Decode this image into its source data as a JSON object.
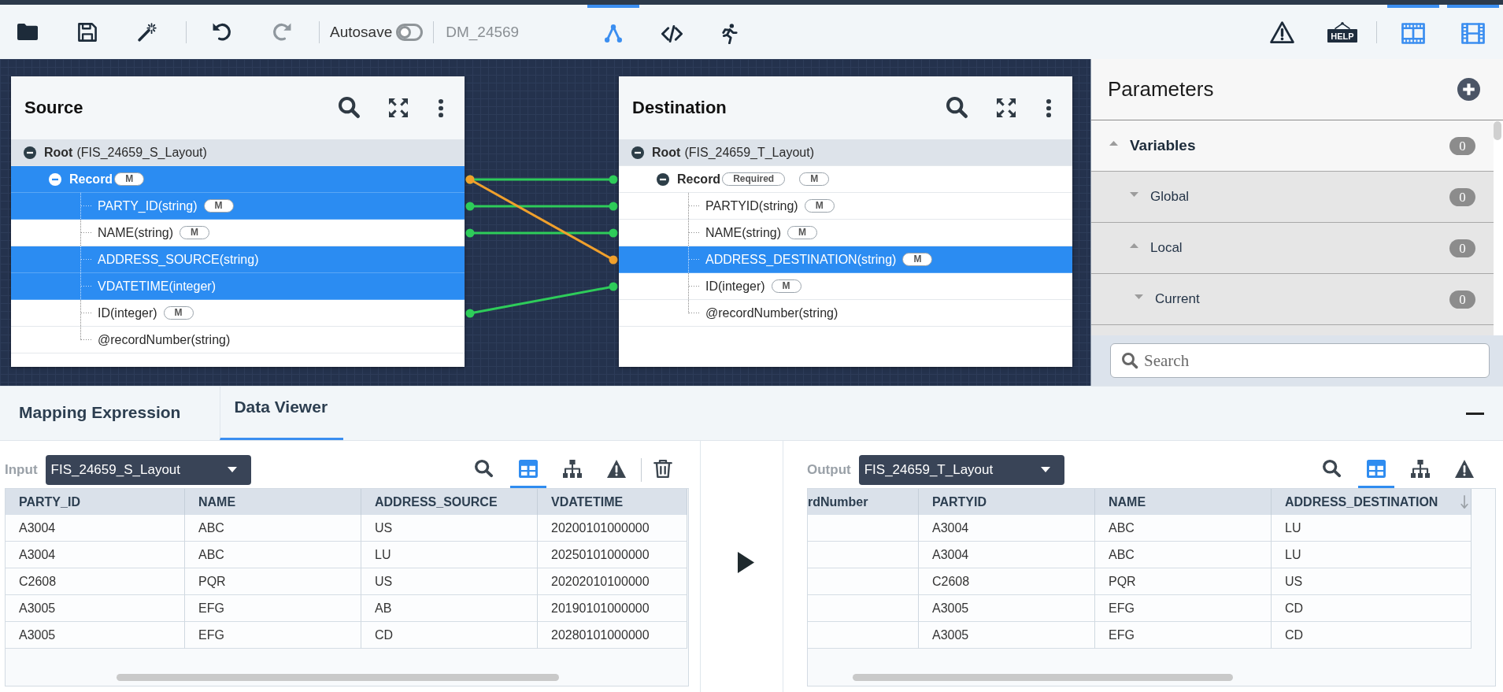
{
  "toolbar": {
    "file_actions": [
      {
        "kind": "open",
        "disabled": false
      },
      {
        "kind": "save",
        "disabled": false
      },
      {
        "kind": "magic",
        "disabled": false
      }
    ],
    "history_actions": [
      {
        "kind": "undo",
        "disabled": false
      },
      {
        "kind": "redo",
        "disabled": true
      }
    ],
    "autosave": {
      "label": "Autosave",
      "on": false
    },
    "document_name": "DM_24569",
    "views": [
      {
        "kind": "mapping",
        "selected": true
      },
      {
        "kind": "code",
        "selected": false
      },
      {
        "kind": "run",
        "selected": false
      }
    ],
    "help": {
      "label": "HELP"
    },
    "layouts": [
      {
        "kind": "columns",
        "selected": true
      },
      {
        "kind": "rows",
        "selected": true
      }
    ]
  },
  "canvas": {
    "source": {
      "title": "Source",
      "tree": [
        {
          "name": "Root",
          "detail": "(FIS_24659_S_Layout)",
          "selected": false,
          "expanded": true,
          "children": [
            {
              "name": "Record",
              "badges": [
                "M"
              ],
              "selected": true,
              "expanded": true,
              "children": [
                {
                  "name": "PARTY_ID(string)",
                  "badges": [
                    "M"
                  ],
                  "selected": true
                },
                {
                  "name": "NAME(string)",
                  "badges": [
                    "M"
                  ],
                  "selected": false
                },
                {
                  "name": "ADDRESS_SOURCE(string)",
                  "selected": true
                },
                {
                  "name": "VDATETIME(integer)",
                  "selected": true
                },
                {
                  "name": "ID(integer)",
                  "badges": [
                    "M"
                  ],
                  "selected": false
                },
                {
                  "name": "@recordNumber(string)",
                  "selected": false
                }
              ]
            }
          ]
        }
      ]
    },
    "destination": {
      "title": "Destination",
      "tree": [
        {
          "name": "Root",
          "detail": "(FIS_24659_T_Layout)",
          "selected": false,
          "expanded": true,
          "children": [
            {
              "name": "Record",
              "badges": [
                "Required",
                "M"
              ],
              "selected": false,
              "expanded": true,
              "children": [
                {
                  "name": "PARTYID(string)",
                  "badges": [
                    "M"
                  ],
                  "selected": false
                },
                {
                  "name": "NAME(string)",
                  "badges": [
                    "M"
                  ],
                  "selected": false
                },
                {
                  "name": "ADDRESS_DESTINATION(string)",
                  "badges": [
                    "M"
                  ],
                  "selected": true
                },
                {
                  "name": "ID(integer)",
                  "badges": [
                    "M"
                  ],
                  "selected": false
                },
                {
                  "name": "@recordNumber(string)",
                  "selected": false
                }
              ]
            }
          ]
        }
      ]
    },
    "mappings": [
      {
        "color": "#2ecc5a"
      },
      {
        "color": "#2ecc5a"
      },
      {
        "color": "#2ecc5a"
      },
      {
        "color": "#2ecc5a"
      },
      {
        "color": "#f0a02c"
      }
    ]
  },
  "parameters": {
    "title": "Parameters",
    "groups": [
      {
        "label": "Variables",
        "count": "0",
        "expanded": true,
        "children": [
          {
            "label": "Global",
            "count": "0",
            "expanded": false
          },
          {
            "label": "Local",
            "count": "0",
            "expanded": true,
            "children": [
              {
                "label": "Current",
                "count": "0",
                "expanded": false
              }
            ]
          }
        ]
      }
    ],
    "search": {
      "placeholder": "Search"
    }
  },
  "bottom_panel": {
    "tabs": [
      {
        "label": "Mapping Expression",
        "selected": false
      },
      {
        "label": "Data Viewer",
        "selected": true
      }
    ],
    "panes": [
      {
        "label": "Input",
        "layout": "FIS_24659_S_Layout",
        "tools": [
          {
            "kind": "search",
            "selected": false
          },
          {
            "kind": "table",
            "selected": true
          },
          {
            "kind": "tree",
            "selected": false
          },
          {
            "kind": "warning",
            "selected": false
          },
          {
            "kind": "delete",
            "selected": false
          }
        ],
        "table": {
          "columns": [
            {
              "label": "PARTY_ID",
              "sorted": false
            },
            {
              "label": "NAME",
              "sorted": false
            },
            {
              "label": "ADDRESS_SOURCE",
              "sorted": false
            },
            {
              "label": "VDATETIME",
              "sorted": false
            }
          ],
          "rows": [
            [
              "A3004",
              "ABC",
              "US",
              "20200101000000"
            ],
            [
              "A3004",
              "ABC",
              "LU",
              "20250101000000"
            ],
            [
              "C2608",
              "PQR",
              "US",
              "20202010100000"
            ],
            [
              "A3005",
              "EFG",
              "AB",
              "20190101000000"
            ],
            [
              "A3005",
              "EFG",
              "CD",
              "20280101000000"
            ]
          ]
        }
      },
      {
        "label": "Output",
        "layout": "FIS_24659_T_Layout",
        "tools": [
          {
            "kind": "search",
            "selected": false
          },
          {
            "kind": "table",
            "selected": true
          },
          {
            "kind": "tree",
            "selected": false
          },
          {
            "kind": "warning",
            "selected": false
          }
        ],
        "table": {
          "columns": [
            {
              "label": "rdNumber",
              "sorted": false
            },
            {
              "label": "PARTYID",
              "sorted": false
            },
            {
              "label": "NAME",
              "sorted": false
            },
            {
              "label": "ADDRESS_DESTINATION",
              "sorted": true
            }
          ],
          "rows": [
            [
              "",
              "A3004",
              "ABC",
              "LU"
            ],
            [
              "",
              "A3004",
              "ABC",
              "LU"
            ],
            [
              "",
              "C2608",
              "PQR",
              "US"
            ],
            [
              "",
              "A3005",
              "EFG",
              "CD"
            ],
            [
              "",
              "A3005",
              "EFG",
              "CD"
            ]
          ]
        }
      }
    ]
  }
}
